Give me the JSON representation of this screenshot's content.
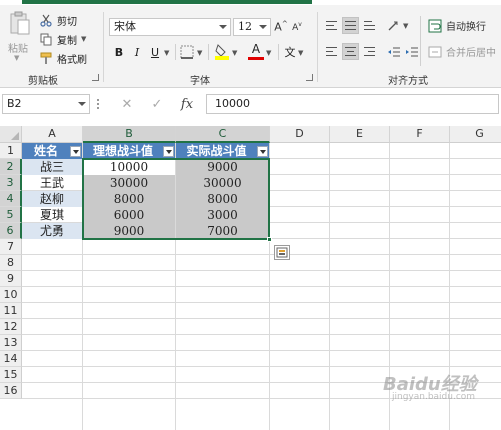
{
  "ribbon": {
    "clipboard": {
      "paste_label": "粘贴",
      "cut_label": "剪切",
      "copy_label": "复制",
      "format_painter_label": "格式刷",
      "group_label": "剪贴板"
    },
    "font": {
      "font_name": "宋体",
      "font_size": "12",
      "bold": "B",
      "italic": "I",
      "underline": "U",
      "wen": "文",
      "group_label": "字体"
    },
    "alignment": {
      "wrap_text_label": "自动换行",
      "merge_center_label": "合并后居中",
      "group_label": "对齐方式"
    }
  },
  "formula_bar": {
    "name_box": "B2",
    "fx": "fx",
    "formula": "10000"
  },
  "grid": {
    "columns": [
      "A",
      "B",
      "C",
      "D",
      "E",
      "F",
      "G"
    ],
    "rows": [
      "1",
      "2",
      "3",
      "4",
      "5",
      "6",
      "7",
      "8",
      "9",
      "10",
      "11",
      "12",
      "13",
      "14",
      "15",
      "16"
    ],
    "headers": [
      "姓名",
      "理想战斗值",
      "实际战斗值"
    ],
    "data": [
      [
        "战三",
        "10000",
        "9000"
      ],
      [
        "王武",
        "30000",
        "30000"
      ],
      [
        "赵柳",
        "8000",
        "8000"
      ],
      [
        "夏琪",
        "6000",
        "3000"
      ],
      [
        "尤勇",
        "9000",
        "7000"
      ]
    ]
  },
  "colors": {
    "accent": "#217346",
    "table_header": "#4f81bd",
    "table_band": "#dbe5f1",
    "selection": "#c9c9c9"
  },
  "watermark": {
    "text": "Baidu经验",
    "sub": "jingyan.baidu.com"
  }
}
